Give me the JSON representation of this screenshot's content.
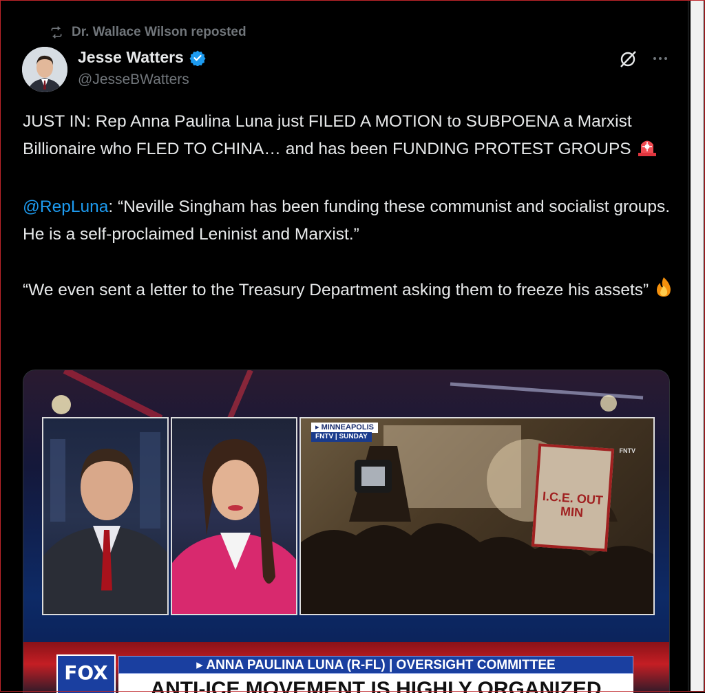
{
  "repost": {
    "icon": "repost-icon",
    "text": "Dr. Wallace Wilson reposted"
  },
  "author": {
    "display_name": "Jesse Watters",
    "handle": "@JesseBWatters",
    "verified": true,
    "verified_color": "#1d9bf0"
  },
  "actions": {
    "grok_icon": "grok-icon",
    "more_icon": "more-icon"
  },
  "tweet": {
    "line1": "JUST IN: Rep Anna Paulina Luna just FILED A MOTION to SUBPOENA a Marxist Billionaire who FLED TO CHINA… and has been FUNDING PROTEST GROUPS",
    "line1_emoji": "🚨",
    "mention": "@RepLuna",
    "line2_rest": ": “Neville Singham has been funding these communist and socialist groups. He is a self-proclaimed Leninist and Marxist.”",
    "line3": "“We even sent a letter to the Treasury Department asking them to freeze his assets”",
    "line3_emoji": "🔥",
    "mention_color": "#1d9bf0"
  },
  "media": {
    "location_tag": "▸ MINNEAPOLIS",
    "location_sub": "FNTV | SUNDAY",
    "fntv_bug": "FNTV",
    "sign_text": "I.C.E. OUT MIN",
    "logo_text": "FOX",
    "chyron_top": "▸ ANNA PAULINA LUNA (R-FL) | OVERSIGHT COMMITTEE",
    "chyron_bottom": "ANTI-ICE MOVEMENT IS HIGHLY ORGANIZED"
  }
}
